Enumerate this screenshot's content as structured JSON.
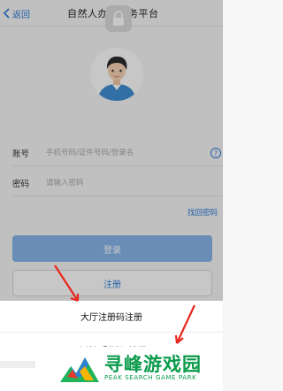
{
  "navbar": {
    "back_label": "返回",
    "title": "自然人办税服务平台"
  },
  "form": {
    "account_label": "账号",
    "account_placeholder": "手机号码/证件号码/登录名",
    "password_label": "密码",
    "password_placeholder": "请输入密码",
    "help_icon": "?",
    "forgot_password": "找回密码",
    "login_button": "登录",
    "register_button": "注册"
  },
  "action_sheet": {
    "items": [
      "大厅注册码注册",
      "人脸识别认证注册"
    ]
  },
  "watermark": {
    "title": "寻峰游戏园",
    "subtitle": "PEAK SEARCH GAME PARK"
  },
  "colors": {
    "accent": "#2d7bd8",
    "login_button": "#88b5eb",
    "annotation_arrow": "#e8261d",
    "watermark": "#0a9a4b"
  },
  "icons": [
    "chevron-left-icon",
    "lock-icon",
    "user-avatar-icon",
    "help-icon",
    "red-arrow-annotation",
    "mountain-logo-icon"
  ]
}
